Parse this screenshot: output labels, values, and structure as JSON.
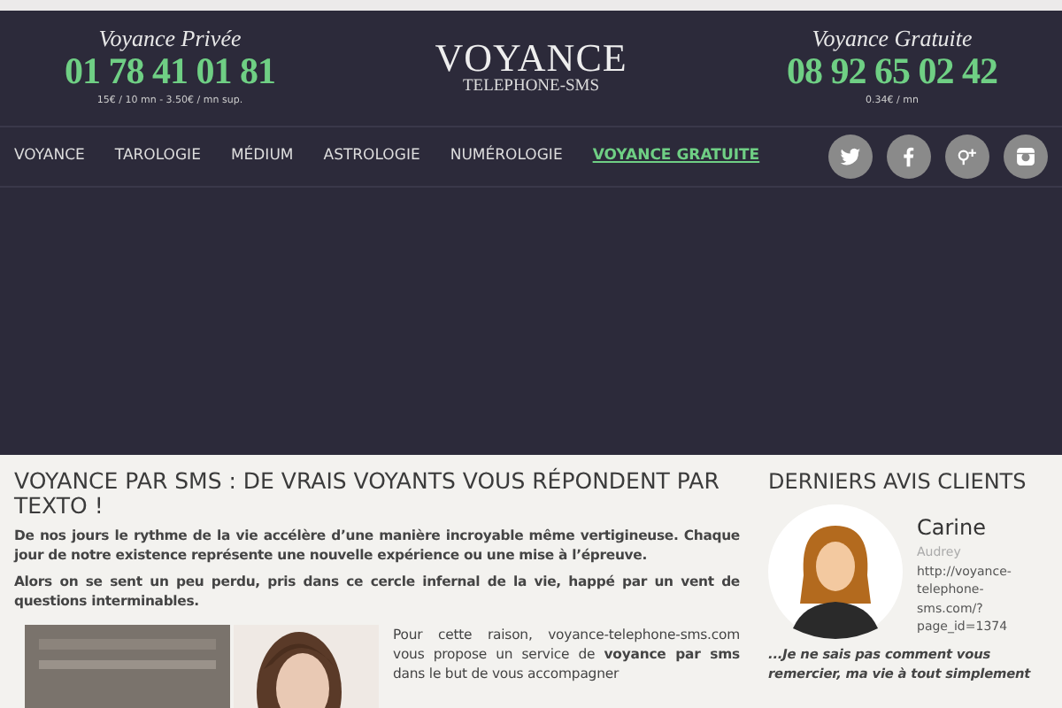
{
  "header": {
    "phones": [
      {
        "title": "Voyance Privée",
        "number": "01 78 41 01 81",
        "price": "15€ / 10 mn - 3.50€ / mn sup."
      },
      {
        "title": "Voyance Gratuite",
        "number": "08 92 65 02 42",
        "price": "0.34€ / mn"
      }
    ],
    "logo": {
      "title": "VOYANCE",
      "subtitle": "TELEPHONE-SMS"
    }
  },
  "nav": {
    "items": [
      {
        "label": "VOYANCE",
        "selected": false
      },
      {
        "label": "TAROLOGIE",
        "selected": false
      },
      {
        "label": "MÉDIUM",
        "selected": false
      },
      {
        "label": "ASTROLOGIE",
        "selected": false
      },
      {
        "label": "NUMÉROLOGIE",
        "selected": false
      },
      {
        "label": "VOYANCE GRATUITE",
        "selected": true
      }
    ],
    "social": [
      {
        "kind": "twitter"
      },
      {
        "kind": "facebook"
      },
      {
        "kind": "googleplus"
      },
      {
        "kind": "instagram"
      }
    ]
  },
  "article": {
    "title": "VOYANCE PAR SMS : DE VRAIS VOYANTS VOUS RÉPONDENT PAR TEXTO !",
    "paragraphs": [
      "De nos jours le rythme de la vie accélère d’une manière incroyable même vertigineuse. Chaque jour de notre existence représente une nouvelle expérience ou une mise à l’épreuve.",
      "Alors on se sent un peu perdu, pris dans ce cercle infernal de la vie, happé par un vent de questions interminables."
    ],
    "side_text": "Pour cette raison, voyance-telephone-sms.com vous propose un service de **voyance par sms** dans le but de vous accompagner"
  },
  "sidebar": {
    "title": "DERNIERS AVIS CLIENTS",
    "review": {
      "name": "Carine",
      "author": "Audrey",
      "link": "http://voyance-telephone-sms.com/?page_id=1374",
      "quote": "...Je ne sais pas comment vous remercier, ma vie à tout simplement"
    }
  }
}
